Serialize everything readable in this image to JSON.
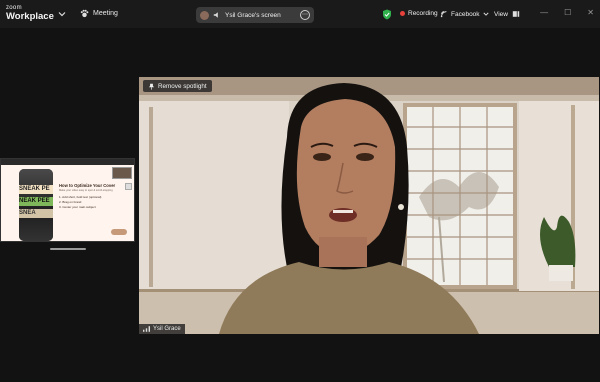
{
  "app": {
    "brand_top": "zoom",
    "brand_bottom": "Workplace"
  },
  "titlebar": {
    "meeting_label": "Meeting",
    "share_label": "Ysil Grace's screen",
    "recording_label": "Recording",
    "live_label": "Facebook",
    "view_label": "View"
  },
  "thumbnail": {
    "title": "How to Optimize Your Cover",
    "subtitle": "Make your video easy to spot & scroll-stopping",
    "items": [
      "1. Add short, bold text (optional)",
      "2. Brag on brand",
      "3. Center your main subject"
    ],
    "phone_text": [
      "SNEAK PE",
      "NEAK PEE",
      "SNEA"
    ]
  },
  "video": {
    "remove_spotlight_label": "Remove spotlight",
    "participant_name": "Ysil Grace"
  },
  "colors": {
    "recording": "#e8413c",
    "shield": "#2fb24c",
    "accent_badge": "#c69a78"
  },
  "icons": [
    "chevron-down-icon",
    "paw-icon",
    "speaker-icon",
    "more-icon",
    "shield-icon",
    "record-dot-icon",
    "live-icon",
    "view-icon",
    "pin-icon",
    "signal-icon"
  ]
}
